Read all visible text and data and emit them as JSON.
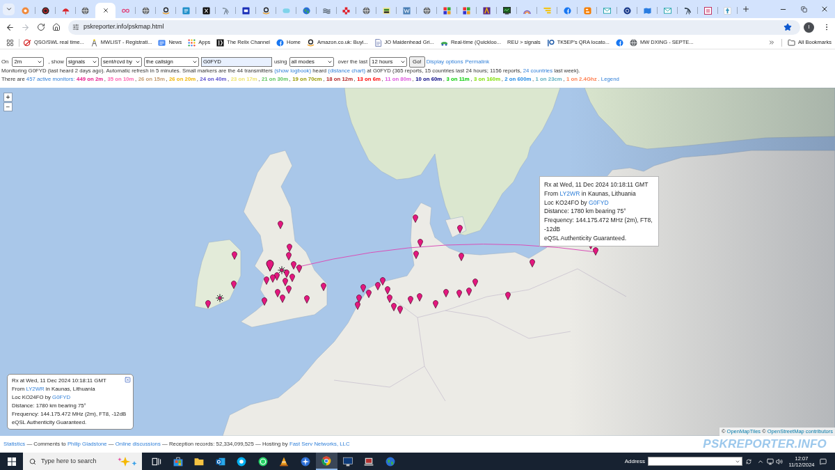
{
  "browser": {
    "tabs": [
      {
        "kind": "gear",
        "selected": false
      },
      {
        "kind": "record",
        "selected": false
      },
      {
        "kind": "umbrella",
        "selected": false
      },
      {
        "kind": "globe",
        "selected": false
      },
      {
        "selected": true
      },
      {
        "kind": "infinity",
        "selected": false
      },
      {
        "kind": "globe",
        "selected": false
      },
      {
        "kind": "smile",
        "selected": false
      },
      {
        "kind": "fm",
        "selected": false
      },
      {
        "kind": "cross",
        "selected": false
      },
      {
        "kind": "antenna",
        "selected": false
      },
      {
        "kind": "dx",
        "selected": false
      },
      {
        "kind": "smile",
        "selected": false
      },
      {
        "kind": "cloud",
        "selected": false
      },
      {
        "kind": "earth",
        "selected": false
      },
      {
        "kind": "waves",
        "selected": false
      },
      {
        "kind": "blocks",
        "selected": false
      },
      {
        "kind": "globe",
        "selected": false
      },
      {
        "kind": "ham",
        "selected": false
      },
      {
        "kind": "wtile",
        "selected": false
      },
      {
        "kind": "globe",
        "selected": false
      },
      {
        "kind": "etc",
        "selected": false
      },
      {
        "kind": "etc",
        "selected": false
      },
      {
        "kind": "brown",
        "selected": false
      },
      {
        "kind": "screen",
        "selected": false
      },
      {
        "kind": "arch",
        "selected": false
      },
      {
        "kind": "stripes",
        "selected": false
      },
      {
        "kind": "fb",
        "selected": false
      },
      {
        "kind": "blogger",
        "selected": false
      },
      {
        "kind": "mail",
        "selected": false
      },
      {
        "kind": "seventy",
        "selected": false
      },
      {
        "kind": "map",
        "selected": false
      },
      {
        "kind": "mail",
        "selected": false
      },
      {
        "kind": "dish",
        "selected": false
      },
      {
        "kind": "pinktile",
        "selected": false
      },
      {
        "kind": "ttile",
        "selected": false
      }
    ],
    "toolbar": {
      "forward_disabled": true,
      "url": "pskreporter.info/pskmap.html",
      "bookmarked": true,
      "profile_initial": "I"
    },
    "bookmarks": [
      {
        "kind": "qso",
        "label": "QSO/SWL real time..."
      },
      {
        "kind": "tower",
        "label": "MWLIST - Registrati..."
      },
      {
        "kind": "news",
        "label": "News"
      },
      {
        "kind": "apps",
        "label": "Apps"
      },
      {
        "kind": "relix",
        "label": "The Relix Channel"
      },
      {
        "kind": "fb",
        "label": "Home"
      },
      {
        "kind": "smile",
        "label": "Amazon.co.uk: Buyi..."
      },
      {
        "kind": "doc",
        "label": "JO Maidenhead Gri..."
      },
      {
        "kind": "car",
        "label": "Real-time (Quickloo..."
      },
      {
        "label": "REU > signals"
      },
      {
        "kind": "ep",
        "label": "TK5EP's QRA locato..."
      },
      {
        "kind": "fb"
      },
      {
        "kind": "globe",
        "label": "MW DXING - SEPTE..."
      }
    ],
    "all_bookmarks": "All Bookmarks"
  },
  "filters": [
    {
      "kind": "label",
      "text": "On"
    },
    {
      "kind": "select",
      "value": "2m"
    },
    {
      "kind": "label",
      "text": ", show"
    },
    {
      "kind": "select",
      "value": "signals"
    },
    {
      "kind": "select",
      "value": "sent/rcvd by"
    },
    {
      "kind": "select",
      "value": "the callsign"
    },
    {
      "kind": "input",
      "value": "G0FYD"
    },
    {
      "kind": "label",
      "text": "using"
    },
    {
      "kind": "select",
      "value": "all modes"
    },
    {
      "kind": "label",
      "text": "over the last"
    },
    {
      "kind": "select",
      "value": "12 hours"
    },
    {
      "kind": "button",
      "text": "Go!"
    },
    {
      "kind": "link",
      "text": "Display options"
    },
    {
      "kind": "link",
      "text": "Permalink"
    }
  ],
  "status_line": [
    {
      "kind": "text",
      "text": "Monitoring G0FYD (last heard 2 days ago). Automatic refresh in 5 minutes. Small markers are the 44 transmitters"
    },
    {
      "kind": "link",
      "text": "(show logbook)"
    },
    {
      "kind": "text",
      "text": "heard"
    },
    {
      "kind": "link",
      "text": "(distance chart)"
    },
    {
      "kind": "text",
      "text": "at G0FYD (365 reports, 15 countries last 24 hours; 1156 reports,"
    },
    {
      "kind": "link",
      "text": "24 countries"
    },
    {
      "kind": "text",
      "text": "last week)."
    }
  ],
  "monitors": {
    "intro": "There are",
    "link": "457 active monitors:",
    "separator": ",",
    "end": ".",
    "legend": "Legend",
    "bands": [
      {
        "text": "449 on 2m",
        "color": "#e8198b"
      },
      {
        "text": "35 on 10m",
        "color": "#ff66b2"
      },
      {
        "text": "26 on 15m",
        "color": "#c49a6c"
      },
      {
        "text": "26 on 20m",
        "color": "#f0b400"
      },
      {
        "text": "24 on 40m",
        "color": "#5a4fcf"
      },
      {
        "text": "23 on 17m",
        "color": "#eee36a"
      },
      {
        "text": "21 on 30m",
        "color": "#5cc45c"
      },
      {
        "text": "19 on 70cm",
        "color": "#999900"
      },
      {
        "text": "18 on 12m",
        "color": "#b22222"
      },
      {
        "text": "13 on 6m",
        "color": "#ff0000"
      },
      {
        "text": "11 on 80m",
        "color": "#dd55dd"
      },
      {
        "text": "10 on 60m",
        "color": "#000080"
      },
      {
        "text": "3 on 11m",
        "color": "#00cc00"
      },
      {
        "text": "3 on 160m",
        "color": "#7fe000"
      },
      {
        "text": "2 on 600m",
        "color": "#1e88e5"
      },
      {
        "text": "1 on 23cm",
        "color": "#5fb0c0"
      },
      {
        "text": "1 on 2.4Ghz",
        "color": "#ff7f50"
      }
    ]
  },
  "map": {
    "zoom_in": "+",
    "zoom_out": "−",
    "hover_info": [
      [
        {
          "kind": "text",
          "text": "Rx at Wed, 11 Dec 2024 10:18:11 GMT"
        }
      ],
      [
        {
          "kind": "text",
          "text": "From"
        },
        {
          "kind": "link",
          "text": "LY2WR"
        },
        {
          "kind": "text",
          "text": "in Kaunas, Lithuania"
        }
      ],
      [
        {
          "kind": "text",
          "text": "Loc KO24FO by"
        },
        {
          "kind": "link",
          "text": "G0FYD"
        }
      ],
      [
        {
          "kind": "text",
          "text": "Distance: 1780 km bearing 75°"
        }
      ],
      [
        {
          "kind": "text",
          "text": "Frequency: 144.175.472 MHz (2m), FT8, -12dB"
        }
      ],
      [
        {
          "kind": "text",
          "text": "eQSL Authenticity Guaranteed."
        }
      ]
    ],
    "popup": [
      [
        {
          "kind": "text",
          "text": "Rx at Wed, 11 Dec 2024 10:18:11 GMT"
        }
      ],
      [
        {
          "kind": "text",
          "text": "From"
        },
        {
          "kind": "link",
          "text": "LY2WR"
        },
        {
          "kind": "text",
          "text": "in Kaunas, Lithuania"
        }
      ],
      [
        {
          "kind": "text",
          "text": "Loc KO24FO by"
        },
        {
          "kind": "link",
          "text": "G0FYD"
        }
      ],
      [
        {
          "kind": "text",
          "text": "Distance: 1780 km bearing 75°"
        }
      ],
      [
        {
          "kind": "text",
          "text": "Frequency: 144.175.472 MHz (2m), FT8, -12dB"
        }
      ],
      [
        {
          "kind": "text",
          "text": "eQSL Authenticity Guaranteed."
        }
      ]
    ],
    "attribution": [
      {
        "kind": "text",
        "text": "©"
      },
      {
        "kind": "link",
        "text": "OpenMapTiles"
      },
      {
        "kind": "text",
        "text": "©"
      },
      {
        "kind": "link",
        "text": "OpenStreetMap contributors"
      }
    ]
  },
  "footer": {
    "segments": [
      {
        "kind": "link",
        "text": "Statistics"
      },
      {
        "kind": "text",
        "text": "— Comments to"
      },
      {
        "kind": "link",
        "text": "Philip Gladstone"
      },
      {
        "kind": "text",
        "text": "—"
      },
      {
        "kind": "link",
        "text": "Online discussions"
      },
      {
        "kind": "text",
        "text": "— Reception records: 52,334,099,525 — Hosting by"
      },
      {
        "kind": "link",
        "text": "Fast Serv Networks, LLC"
      }
    ],
    "brand": "PSKREPORTER.INFO"
  },
  "taskbar": {
    "search_placeholder": "Type here to search",
    "apps": [
      {
        "kind": "taskview",
        "active": false
      },
      {
        "kind": "store",
        "active": false
      },
      {
        "kind": "folder",
        "active": false
      },
      {
        "kind": "outlook",
        "active": false
      },
      {
        "kind": "skype",
        "active": false
      },
      {
        "kind": "whatsapp",
        "active": false
      },
      {
        "kind": "cone",
        "active": false
      },
      {
        "kind": "compass",
        "active": false
      },
      {
        "kind": "chrome",
        "active": true
      },
      {
        "kind": "monitor",
        "active": false
      },
      {
        "kind": "laptop",
        "active": false
      },
      {
        "kind": "earth",
        "active": false
      }
    ],
    "address_label": "Address",
    "time": "12:07",
    "date": "11/12/2024"
  }
}
